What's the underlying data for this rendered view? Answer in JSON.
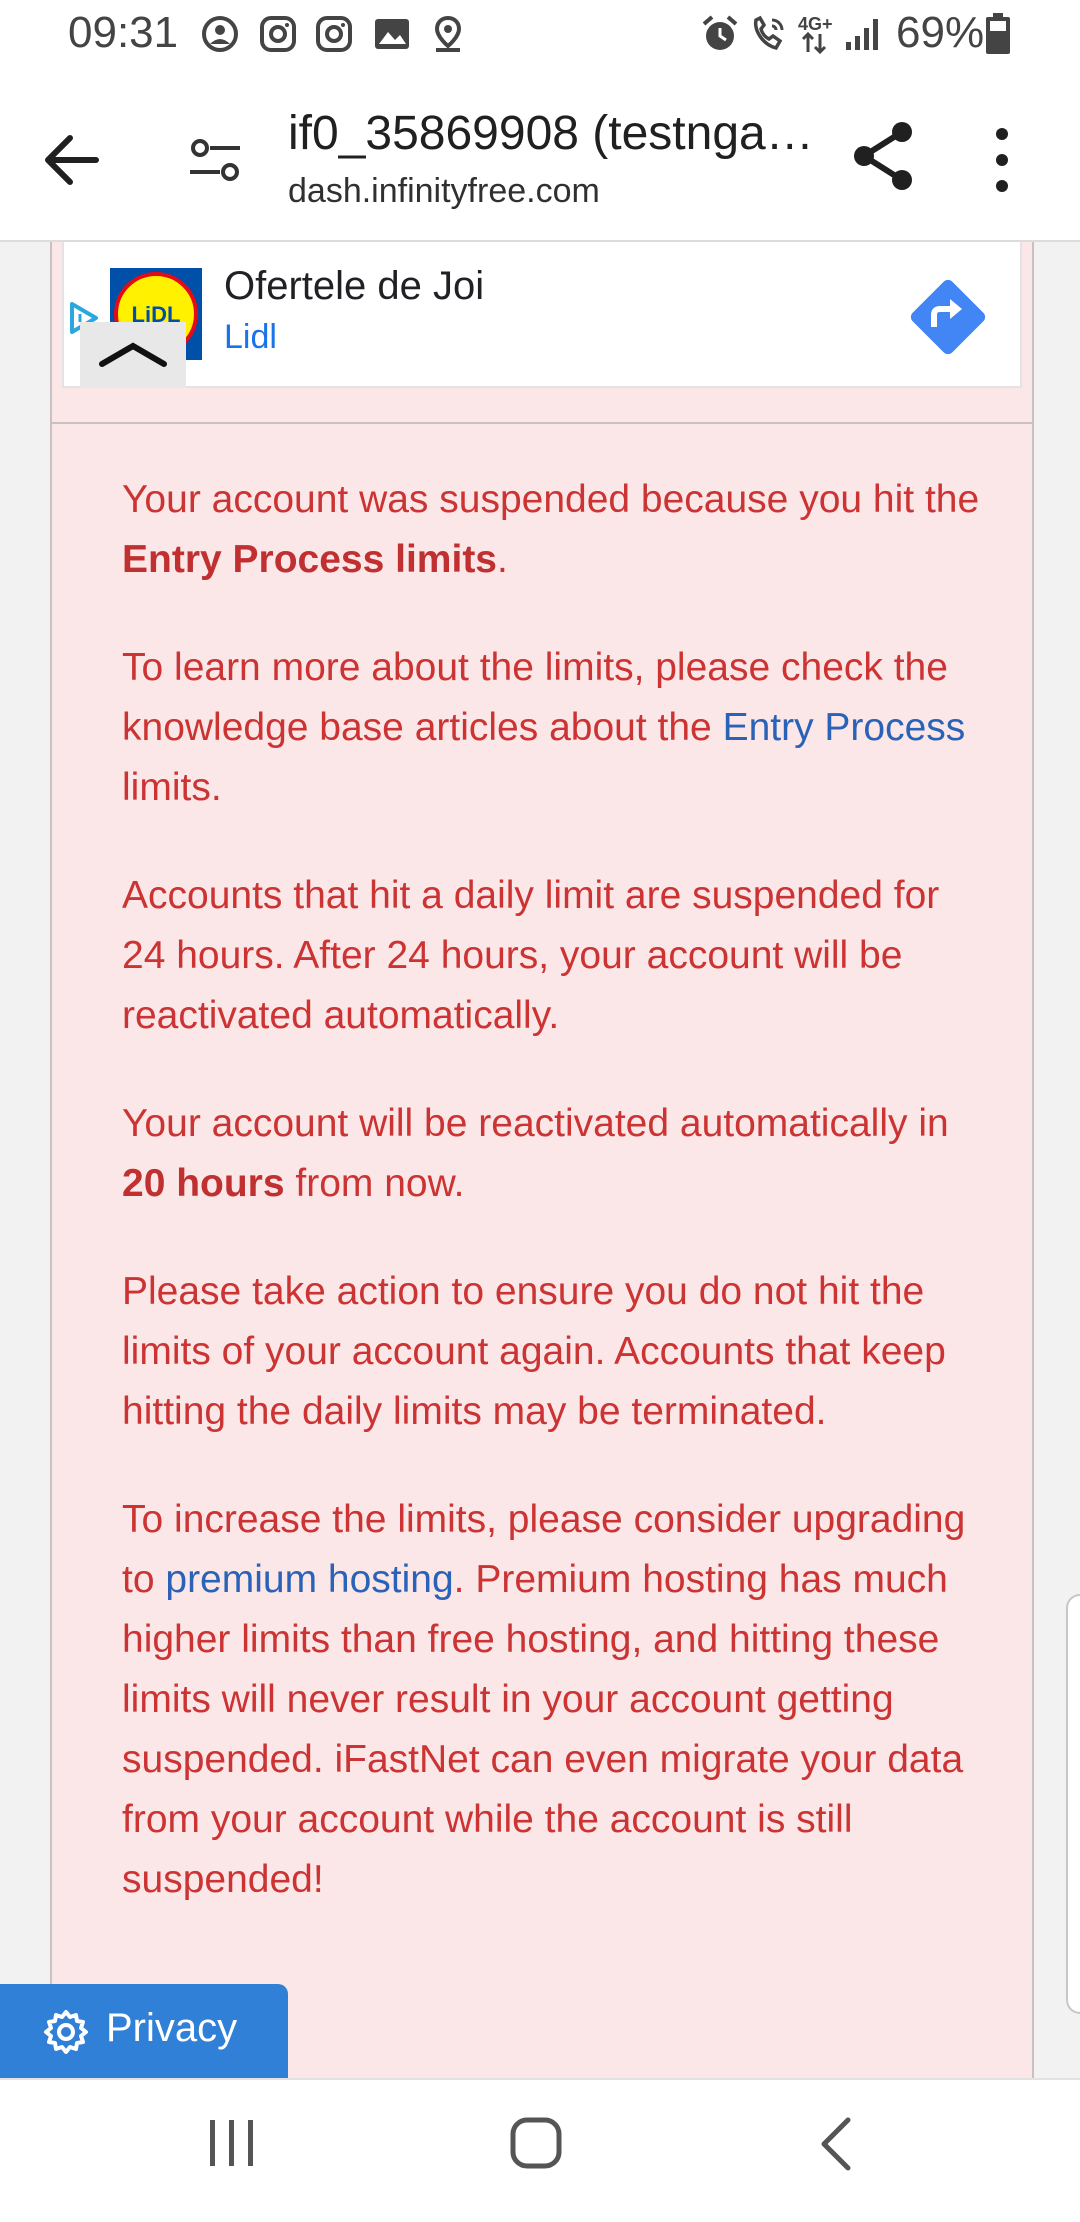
{
  "status_bar": {
    "time": "09:31",
    "battery_percent": "69%",
    "network": "4G+",
    "left_icons": [
      "face-icon",
      "instagram-icon",
      "instagram-icon",
      "gallery-icon",
      "location-icon"
    ],
    "right_icons": [
      "alarm-icon",
      "wifi-call-icon",
      "signal-icon",
      "battery-icon"
    ]
  },
  "browser": {
    "title": "if0_35869908 (testnga…",
    "url": "dash.infinityfree.com"
  },
  "ad": {
    "title": "Ofertele de Joi",
    "advertiser": "Lidl",
    "logo_text": "LiDL"
  },
  "content": {
    "p1_pre": "Your account was suspended because you hit the ",
    "p1_bold": "Entry Process limits",
    "p1_post": ".",
    "p2_pre": "To learn more about the limits, please check the knowledge base articles about the ",
    "p2_link": "Entry Process",
    "p2_post": " limits.",
    "p3": "Accounts that hit a daily limit are suspended for 24 hours. After 24 hours, your account will be reactivated automatically.",
    "p4_pre": "Your account will be reactivated automatically in ",
    "p4_bold": "20 hours",
    "p4_post": " from now.",
    "p5": "Please take action to ensure you do not hit the limits of your account again. Accounts that keep hitting the daily limits may be terminated.",
    "p6_pre": "To increase the limits, please consider upgrading to ",
    "p6_link": "premium hosting",
    "p6_post": ". Premium hosting has much higher limits than free hosting, and hitting these limits will never result in your account getting suspended. iFastNet can even migrate your data from your account while the account is still suspended!"
  },
  "privacy": {
    "label": "Privacy"
  },
  "colors": {
    "card_bg": "#fbe7e8",
    "text_red": "#cc3333",
    "link_blue": "#2a62b8",
    "privacy_blue": "#2f80d6"
  }
}
